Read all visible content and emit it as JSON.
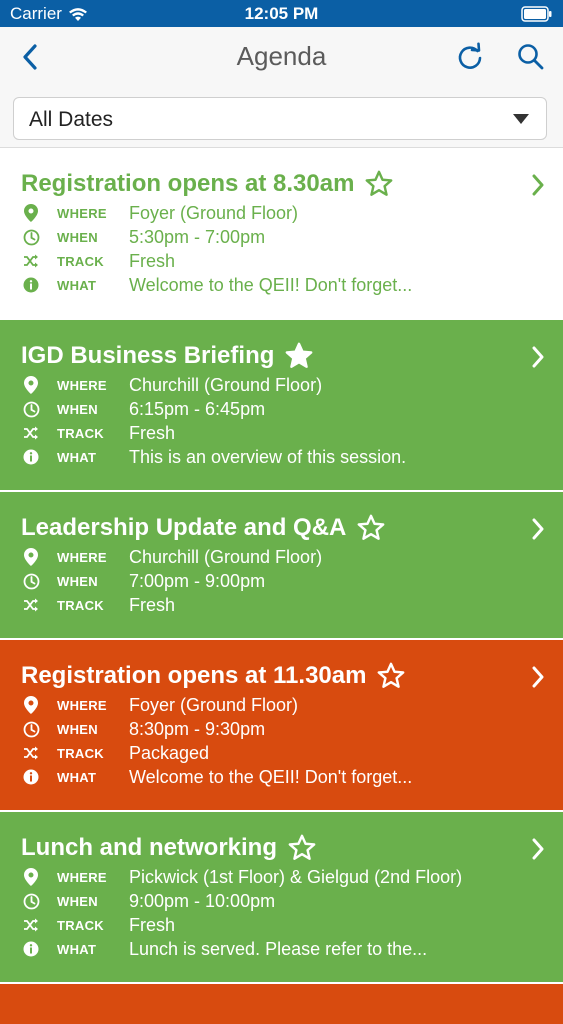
{
  "status_bar": {
    "carrier": "Carrier",
    "time": "12:05 PM"
  },
  "nav": {
    "title": "Agenda"
  },
  "filter": {
    "value": "All Dates"
  },
  "labels": {
    "where": "WHERE",
    "when": "WHEN",
    "track": "TRACK",
    "what": "WHAT"
  },
  "colors": {
    "green": "#6ab04c",
    "orange": "#d84b0f",
    "nav_blue": "#0b5fa5"
  },
  "sessions": [
    {
      "title": "Registration opens at 8.30am",
      "starred": false,
      "where": "Foyer (Ground Floor)",
      "when": "5:30pm - 7:00pm",
      "track": "Fresh",
      "what": "Welcome to the QEII! Don't forget..."
    },
    {
      "title": "IGD Business Briefing",
      "starred": true,
      "where": "Churchill (Ground Floor)",
      "when": "6:15pm - 6:45pm",
      "track": "Fresh",
      "what": "This is an overview of this session."
    },
    {
      "title": "Leadership Update and Q&A",
      "starred": false,
      "where": "Churchill (Ground Floor)",
      "when": "7:00pm - 9:00pm",
      "track": "Fresh",
      "what": ""
    },
    {
      "title": "Registration opens at 11.30am",
      "starred": false,
      "where": "Foyer (Ground Floor)",
      "when": "8:30pm - 9:30pm",
      "track": "Packaged",
      "what": "Welcome to the QEII! Don't forget..."
    },
    {
      "title": "Lunch and networking",
      "starred": false,
      "where": "Pickwick (1st Floor) & Gielgud (2nd Floor)",
      "when": "9:00pm - 10:00pm",
      "track": "Fresh",
      "what": "Lunch is served. Please refer to the..."
    }
  ]
}
